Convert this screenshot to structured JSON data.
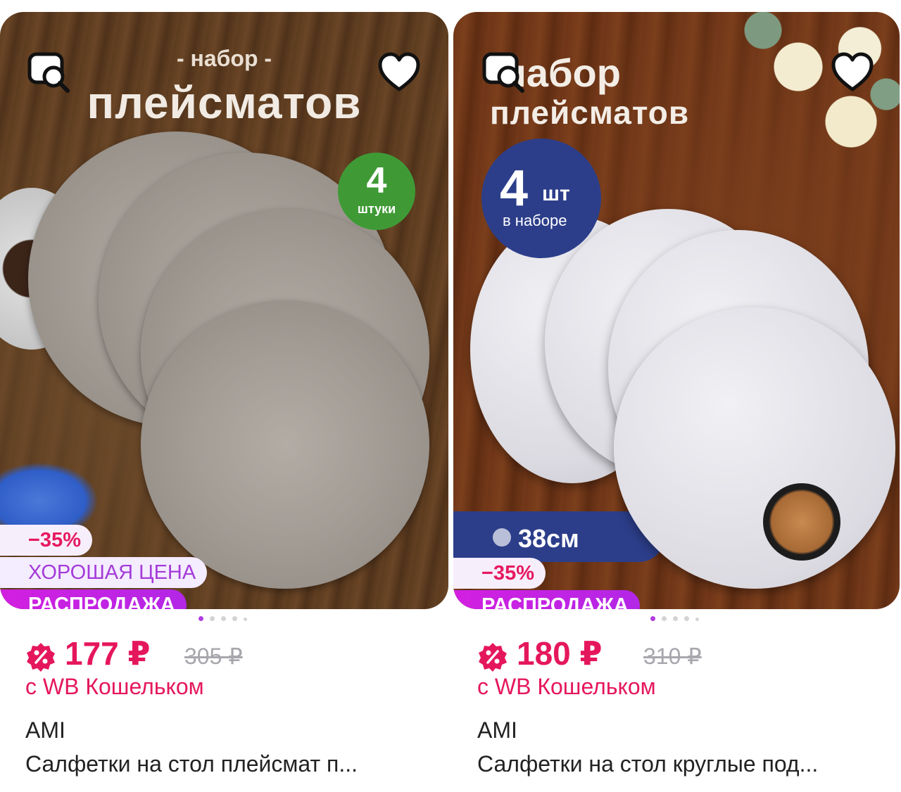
{
  "products": [
    {
      "image": {
        "heading_small": "- набор -",
        "heading_big": "плейсматов",
        "count_number": "4",
        "count_word": "штуки"
      },
      "badges": {
        "discount": "−35%",
        "good_price": "ХОРОШАЯ ЦЕНА",
        "sale": "РАСПРОДАЖА"
      },
      "price": "177 ₽",
      "old_price": "305 ₽",
      "wallet_note": "с WB Кошельком",
      "brand": "AMI",
      "title": "Салфетки на стол плейсмат п..."
    },
    {
      "image": {
        "heading_top": "набор",
        "heading_big": "плейсматов",
        "count_number": "4",
        "count_unit": "шт",
        "count_word": "в наборе",
        "size_label": "38см"
      },
      "badges": {
        "discount": "−35%",
        "sale": "РАСПРОДАЖА"
      },
      "price": "180 ₽",
      "old_price": "310 ₽",
      "wallet_note": "с WB Кошельком",
      "brand": "AMI",
      "title": "Салфетки на стол круглые под..."
    }
  ],
  "colors": {
    "price": "#e5175c",
    "sale_badge": "#b327e6",
    "good_price_text": "#a43bd8",
    "active_dot": "#b13ce0"
  },
  "icons": [
    "image-search-icon",
    "favorite-heart-icon",
    "wallet-discount-icon"
  ]
}
